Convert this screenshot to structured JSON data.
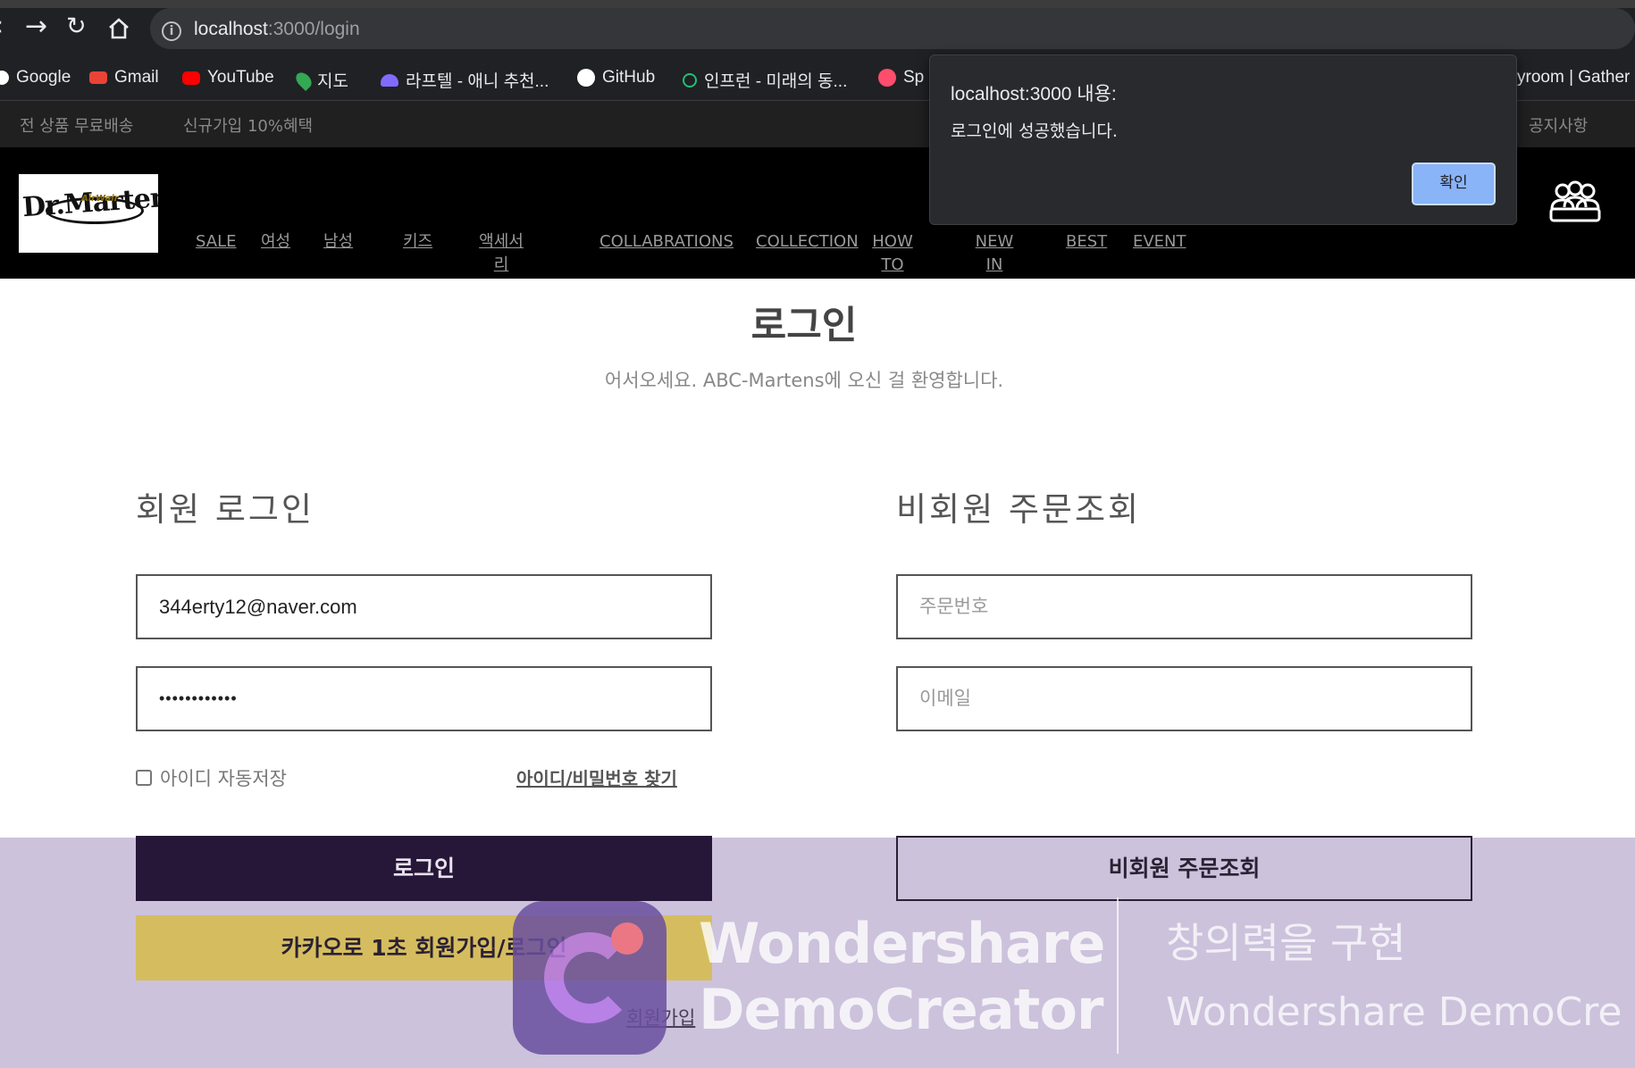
{
  "browser": {
    "url_host": "localhost",
    "url_path": ":3000/login",
    "bookmarks": [
      {
        "label": "Google",
        "icon": "google-icon",
        "color": "#4285f4"
      },
      {
        "label": "Gmail",
        "icon": "gmail-icon",
        "color": "#ea4335"
      },
      {
        "label": "YouTube",
        "icon": "youtube-icon",
        "color": "#ff0000"
      },
      {
        "label": "지도",
        "icon": "maps-icon",
        "color": "#34a853"
      },
      {
        "label": "라프텔 - 애니 추천...",
        "icon": "laftel-icon",
        "color": "#816bff"
      },
      {
        "label": "GitHub",
        "icon": "github-icon",
        "color": "#ffffff"
      },
      {
        "label": "인프런 - 미래의 동...",
        "icon": "inflearn-icon",
        "color": "#1dc078"
      },
      {
        "label": "Sp",
        "icon": "sp-icon",
        "color": "#ff4d6d"
      },
      {
        "label": "yroom | Gather",
        "icon": "",
        "color": ""
      }
    ]
  },
  "dialog": {
    "title": "localhost:3000 내용:",
    "message": "로그인에 성공했습니다.",
    "ok_label": "확인"
  },
  "site": {
    "notice_left": [
      "전 상품 무료배송",
      "신규가입 10%혜택"
    ],
    "notice_right": "공지사항",
    "logo_text": "Dr.Martens",
    "logo_sub": "AirWair",
    "menu": [
      "SALE",
      "여성",
      "남성",
      "키즈",
      "액세서리",
      "COLLABRATIONS",
      "COLLECTION",
      "HOW TO",
      "NEW IN",
      "BEST",
      "EVENT"
    ]
  },
  "login": {
    "title": "로그인",
    "subtitle": "어서오세요. ABC-Martens에 오신 걸 환영합니다.",
    "member_title": "회원 로그인",
    "email_value": "344erty12@naver.com",
    "password_value": "••••••••••••",
    "remember_label": "아이디 자동저장",
    "find_label": "아이디/비밀번호 찾기",
    "login_button": "로그인",
    "kakao_button": "카카오로 1초 회원가입/로그인",
    "signup_link": "회원가입",
    "guest_title": "비회원 주문조회",
    "order_placeholder": "주문번호",
    "email_placeholder": "이메일",
    "guest_button": "비회원 주문조회"
  },
  "watermark": {
    "line1": "Wondershare",
    "line2": "DemoCreator",
    "right1": "창의력을 구현",
    "right2": "Wondershare DemoCre"
  }
}
